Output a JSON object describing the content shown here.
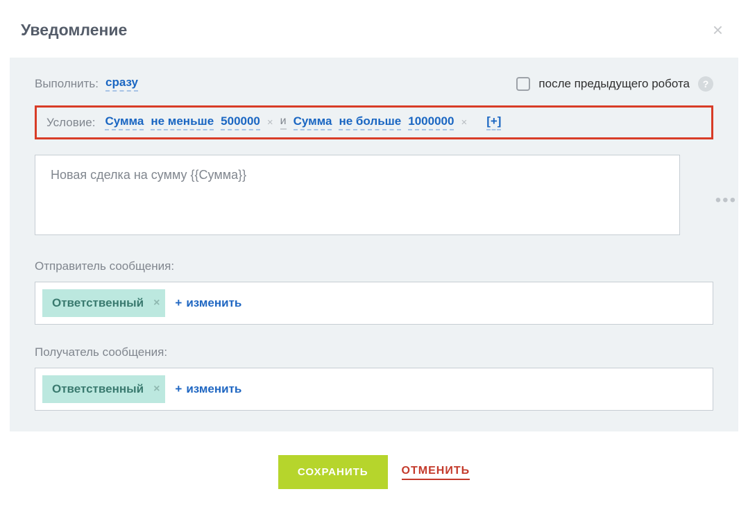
{
  "dialog": {
    "title": "Уведомление"
  },
  "execute": {
    "label": "Выполнить:",
    "timing": "сразу",
    "afterPrevious": "после предыдущего робота"
  },
  "condition": {
    "label": "Условие:",
    "items": [
      {
        "field": "Сумма",
        "operator": "не меньше",
        "value": "500000"
      },
      {
        "field": "Сумма",
        "operator": "не больше",
        "value": "1000000"
      }
    ],
    "joiner": "и",
    "add": "[+]"
  },
  "message": {
    "value": "Новая сделка на сумму {{Сумма}}"
  },
  "sender": {
    "label": "Отправитель сообщения:",
    "tag": "Ответственный",
    "change": "изменить"
  },
  "recipient": {
    "label": "Получатель сообщения:",
    "tag": "Ответственный",
    "change": "изменить"
  },
  "footer": {
    "save": "СОХРАНИТЬ",
    "cancel": "ОТМЕНИТЬ"
  }
}
